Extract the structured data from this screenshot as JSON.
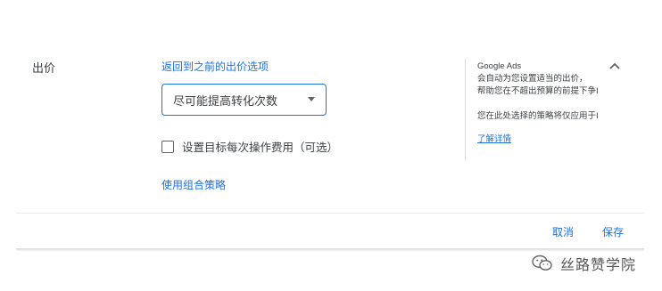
{
  "bidding": {
    "section_label": "出价",
    "back_link": "返回到之前的出价选项",
    "strategy_select": {
      "selected": "尽可能提高转化次数"
    },
    "target_cpa_checkbox": {
      "label": "设置目标每次操作费用（可选）",
      "checked": false
    },
    "portfolio_link": "使用组合策略"
  },
  "help_panel": {
    "title": "Google Ads",
    "lines": [
      "会自动为您设置适当的出价，",
      "帮助您在不超出预算的前提下争I"
    ],
    "note": "您在此处选择的策略将仅应用于I",
    "learn_more": "了解详情"
  },
  "footer": {
    "cancel_label": "取消",
    "save_label": "保存"
  },
  "watermark": {
    "text": "丝路赞学院",
    "icon": "wechat-icon"
  },
  "colors": {
    "accent": "#1a73e8",
    "text": "#3c4043",
    "divider": "#dadce0"
  }
}
